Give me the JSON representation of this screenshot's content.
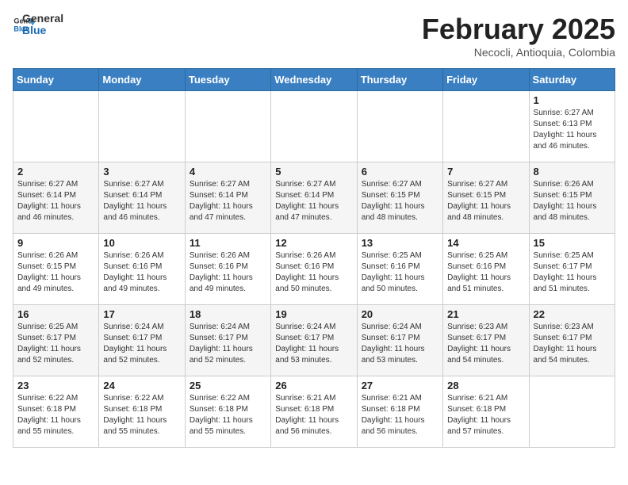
{
  "header": {
    "logo_general": "General",
    "logo_blue": "Blue",
    "month_title": "February 2025",
    "location": "Necocli, Antioquia, Colombia"
  },
  "weekdays": [
    "Sunday",
    "Monday",
    "Tuesday",
    "Wednesday",
    "Thursday",
    "Friday",
    "Saturday"
  ],
  "weeks": [
    [
      {
        "day": "",
        "info": ""
      },
      {
        "day": "",
        "info": ""
      },
      {
        "day": "",
        "info": ""
      },
      {
        "day": "",
        "info": ""
      },
      {
        "day": "",
        "info": ""
      },
      {
        "day": "",
        "info": ""
      },
      {
        "day": "1",
        "info": "Sunrise: 6:27 AM\nSunset: 6:13 PM\nDaylight: 11 hours\nand 46 minutes."
      }
    ],
    [
      {
        "day": "2",
        "info": "Sunrise: 6:27 AM\nSunset: 6:14 PM\nDaylight: 11 hours\nand 46 minutes."
      },
      {
        "day": "3",
        "info": "Sunrise: 6:27 AM\nSunset: 6:14 PM\nDaylight: 11 hours\nand 46 minutes."
      },
      {
        "day": "4",
        "info": "Sunrise: 6:27 AM\nSunset: 6:14 PM\nDaylight: 11 hours\nand 47 minutes."
      },
      {
        "day": "5",
        "info": "Sunrise: 6:27 AM\nSunset: 6:14 PM\nDaylight: 11 hours\nand 47 minutes."
      },
      {
        "day": "6",
        "info": "Sunrise: 6:27 AM\nSunset: 6:15 PM\nDaylight: 11 hours\nand 48 minutes."
      },
      {
        "day": "7",
        "info": "Sunrise: 6:27 AM\nSunset: 6:15 PM\nDaylight: 11 hours\nand 48 minutes."
      },
      {
        "day": "8",
        "info": "Sunrise: 6:26 AM\nSunset: 6:15 PM\nDaylight: 11 hours\nand 48 minutes."
      }
    ],
    [
      {
        "day": "9",
        "info": "Sunrise: 6:26 AM\nSunset: 6:15 PM\nDaylight: 11 hours\nand 49 minutes."
      },
      {
        "day": "10",
        "info": "Sunrise: 6:26 AM\nSunset: 6:16 PM\nDaylight: 11 hours\nand 49 minutes."
      },
      {
        "day": "11",
        "info": "Sunrise: 6:26 AM\nSunset: 6:16 PM\nDaylight: 11 hours\nand 49 minutes."
      },
      {
        "day": "12",
        "info": "Sunrise: 6:26 AM\nSunset: 6:16 PM\nDaylight: 11 hours\nand 50 minutes."
      },
      {
        "day": "13",
        "info": "Sunrise: 6:25 AM\nSunset: 6:16 PM\nDaylight: 11 hours\nand 50 minutes."
      },
      {
        "day": "14",
        "info": "Sunrise: 6:25 AM\nSunset: 6:16 PM\nDaylight: 11 hours\nand 51 minutes."
      },
      {
        "day": "15",
        "info": "Sunrise: 6:25 AM\nSunset: 6:17 PM\nDaylight: 11 hours\nand 51 minutes."
      }
    ],
    [
      {
        "day": "16",
        "info": "Sunrise: 6:25 AM\nSunset: 6:17 PM\nDaylight: 11 hours\nand 52 minutes."
      },
      {
        "day": "17",
        "info": "Sunrise: 6:24 AM\nSunset: 6:17 PM\nDaylight: 11 hours\nand 52 minutes."
      },
      {
        "day": "18",
        "info": "Sunrise: 6:24 AM\nSunset: 6:17 PM\nDaylight: 11 hours\nand 52 minutes."
      },
      {
        "day": "19",
        "info": "Sunrise: 6:24 AM\nSunset: 6:17 PM\nDaylight: 11 hours\nand 53 minutes."
      },
      {
        "day": "20",
        "info": "Sunrise: 6:24 AM\nSunset: 6:17 PM\nDaylight: 11 hours\nand 53 minutes."
      },
      {
        "day": "21",
        "info": "Sunrise: 6:23 AM\nSunset: 6:17 PM\nDaylight: 11 hours\nand 54 minutes."
      },
      {
        "day": "22",
        "info": "Sunrise: 6:23 AM\nSunset: 6:17 PM\nDaylight: 11 hours\nand 54 minutes."
      }
    ],
    [
      {
        "day": "23",
        "info": "Sunrise: 6:22 AM\nSunset: 6:18 PM\nDaylight: 11 hours\nand 55 minutes."
      },
      {
        "day": "24",
        "info": "Sunrise: 6:22 AM\nSunset: 6:18 PM\nDaylight: 11 hours\nand 55 minutes."
      },
      {
        "day": "25",
        "info": "Sunrise: 6:22 AM\nSunset: 6:18 PM\nDaylight: 11 hours\nand 55 minutes."
      },
      {
        "day": "26",
        "info": "Sunrise: 6:21 AM\nSunset: 6:18 PM\nDaylight: 11 hours\nand 56 minutes."
      },
      {
        "day": "27",
        "info": "Sunrise: 6:21 AM\nSunset: 6:18 PM\nDaylight: 11 hours\nand 56 minutes."
      },
      {
        "day": "28",
        "info": "Sunrise: 6:21 AM\nSunset: 6:18 PM\nDaylight: 11 hours\nand 57 minutes."
      },
      {
        "day": "",
        "info": ""
      }
    ]
  ]
}
